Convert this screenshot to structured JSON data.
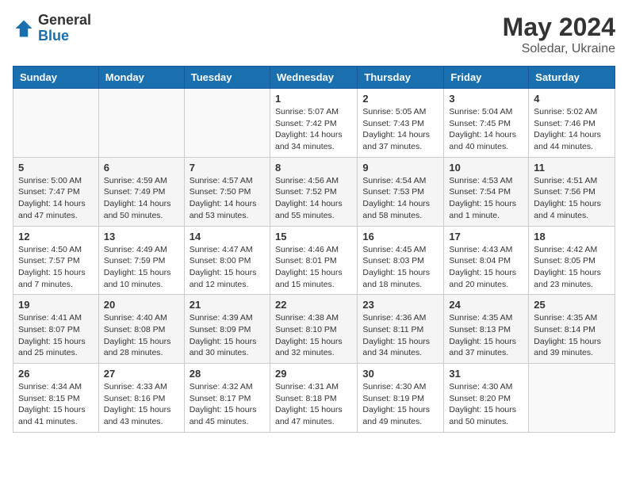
{
  "logo": {
    "general": "General",
    "blue": "Blue"
  },
  "title": {
    "month": "May 2024",
    "location": "Soledar, Ukraine"
  },
  "weekdays": [
    "Sunday",
    "Monday",
    "Tuesday",
    "Wednesday",
    "Thursday",
    "Friday",
    "Saturday"
  ],
  "weeks": [
    [
      {
        "day": "",
        "info": ""
      },
      {
        "day": "",
        "info": ""
      },
      {
        "day": "",
        "info": ""
      },
      {
        "day": "1",
        "sunrise": "Sunrise: 5:07 AM",
        "sunset": "Sunset: 7:42 PM",
        "daylight": "Daylight: 14 hours and 34 minutes."
      },
      {
        "day": "2",
        "sunrise": "Sunrise: 5:05 AM",
        "sunset": "Sunset: 7:43 PM",
        "daylight": "Daylight: 14 hours and 37 minutes."
      },
      {
        "day": "3",
        "sunrise": "Sunrise: 5:04 AM",
        "sunset": "Sunset: 7:45 PM",
        "daylight": "Daylight: 14 hours and 40 minutes."
      },
      {
        "day": "4",
        "sunrise": "Sunrise: 5:02 AM",
        "sunset": "Sunset: 7:46 PM",
        "daylight": "Daylight: 14 hours and 44 minutes."
      }
    ],
    [
      {
        "day": "5",
        "sunrise": "Sunrise: 5:00 AM",
        "sunset": "Sunset: 7:47 PM",
        "daylight": "Daylight: 14 hours and 47 minutes."
      },
      {
        "day": "6",
        "sunrise": "Sunrise: 4:59 AM",
        "sunset": "Sunset: 7:49 PM",
        "daylight": "Daylight: 14 hours and 50 minutes."
      },
      {
        "day": "7",
        "sunrise": "Sunrise: 4:57 AM",
        "sunset": "Sunset: 7:50 PM",
        "daylight": "Daylight: 14 hours and 53 minutes."
      },
      {
        "day": "8",
        "sunrise": "Sunrise: 4:56 AM",
        "sunset": "Sunset: 7:52 PM",
        "daylight": "Daylight: 14 hours and 55 minutes."
      },
      {
        "day": "9",
        "sunrise": "Sunrise: 4:54 AM",
        "sunset": "Sunset: 7:53 PM",
        "daylight": "Daylight: 14 hours and 58 minutes."
      },
      {
        "day": "10",
        "sunrise": "Sunrise: 4:53 AM",
        "sunset": "Sunset: 7:54 PM",
        "daylight": "Daylight: 15 hours and 1 minute."
      },
      {
        "day": "11",
        "sunrise": "Sunrise: 4:51 AM",
        "sunset": "Sunset: 7:56 PM",
        "daylight": "Daylight: 15 hours and 4 minutes."
      }
    ],
    [
      {
        "day": "12",
        "sunrise": "Sunrise: 4:50 AM",
        "sunset": "Sunset: 7:57 PM",
        "daylight": "Daylight: 15 hours and 7 minutes."
      },
      {
        "day": "13",
        "sunrise": "Sunrise: 4:49 AM",
        "sunset": "Sunset: 7:59 PM",
        "daylight": "Daylight: 15 hours and 10 minutes."
      },
      {
        "day": "14",
        "sunrise": "Sunrise: 4:47 AM",
        "sunset": "Sunset: 8:00 PM",
        "daylight": "Daylight: 15 hours and 12 minutes."
      },
      {
        "day": "15",
        "sunrise": "Sunrise: 4:46 AM",
        "sunset": "Sunset: 8:01 PM",
        "daylight": "Daylight: 15 hours and 15 minutes."
      },
      {
        "day": "16",
        "sunrise": "Sunrise: 4:45 AM",
        "sunset": "Sunset: 8:03 PM",
        "daylight": "Daylight: 15 hours and 18 minutes."
      },
      {
        "day": "17",
        "sunrise": "Sunrise: 4:43 AM",
        "sunset": "Sunset: 8:04 PM",
        "daylight": "Daylight: 15 hours and 20 minutes."
      },
      {
        "day": "18",
        "sunrise": "Sunrise: 4:42 AM",
        "sunset": "Sunset: 8:05 PM",
        "daylight": "Daylight: 15 hours and 23 minutes."
      }
    ],
    [
      {
        "day": "19",
        "sunrise": "Sunrise: 4:41 AM",
        "sunset": "Sunset: 8:07 PM",
        "daylight": "Daylight: 15 hours and 25 minutes."
      },
      {
        "day": "20",
        "sunrise": "Sunrise: 4:40 AM",
        "sunset": "Sunset: 8:08 PM",
        "daylight": "Daylight: 15 hours and 28 minutes."
      },
      {
        "day": "21",
        "sunrise": "Sunrise: 4:39 AM",
        "sunset": "Sunset: 8:09 PM",
        "daylight": "Daylight: 15 hours and 30 minutes."
      },
      {
        "day": "22",
        "sunrise": "Sunrise: 4:38 AM",
        "sunset": "Sunset: 8:10 PM",
        "daylight": "Daylight: 15 hours and 32 minutes."
      },
      {
        "day": "23",
        "sunrise": "Sunrise: 4:36 AM",
        "sunset": "Sunset: 8:11 PM",
        "daylight": "Daylight: 15 hours and 34 minutes."
      },
      {
        "day": "24",
        "sunrise": "Sunrise: 4:35 AM",
        "sunset": "Sunset: 8:13 PM",
        "daylight": "Daylight: 15 hours and 37 minutes."
      },
      {
        "day": "25",
        "sunrise": "Sunrise: 4:35 AM",
        "sunset": "Sunset: 8:14 PM",
        "daylight": "Daylight: 15 hours and 39 minutes."
      }
    ],
    [
      {
        "day": "26",
        "sunrise": "Sunrise: 4:34 AM",
        "sunset": "Sunset: 8:15 PM",
        "daylight": "Daylight: 15 hours and 41 minutes."
      },
      {
        "day": "27",
        "sunrise": "Sunrise: 4:33 AM",
        "sunset": "Sunset: 8:16 PM",
        "daylight": "Daylight: 15 hours and 43 minutes."
      },
      {
        "day": "28",
        "sunrise": "Sunrise: 4:32 AM",
        "sunset": "Sunset: 8:17 PM",
        "daylight": "Daylight: 15 hours and 45 minutes."
      },
      {
        "day": "29",
        "sunrise": "Sunrise: 4:31 AM",
        "sunset": "Sunset: 8:18 PM",
        "daylight": "Daylight: 15 hours and 47 minutes."
      },
      {
        "day": "30",
        "sunrise": "Sunrise: 4:30 AM",
        "sunset": "Sunset: 8:19 PM",
        "daylight": "Daylight: 15 hours and 49 minutes."
      },
      {
        "day": "31",
        "sunrise": "Sunrise: 4:30 AM",
        "sunset": "Sunset: 8:20 PM",
        "daylight": "Daylight: 15 hours and 50 minutes."
      },
      {
        "day": "",
        "info": ""
      }
    ]
  ]
}
